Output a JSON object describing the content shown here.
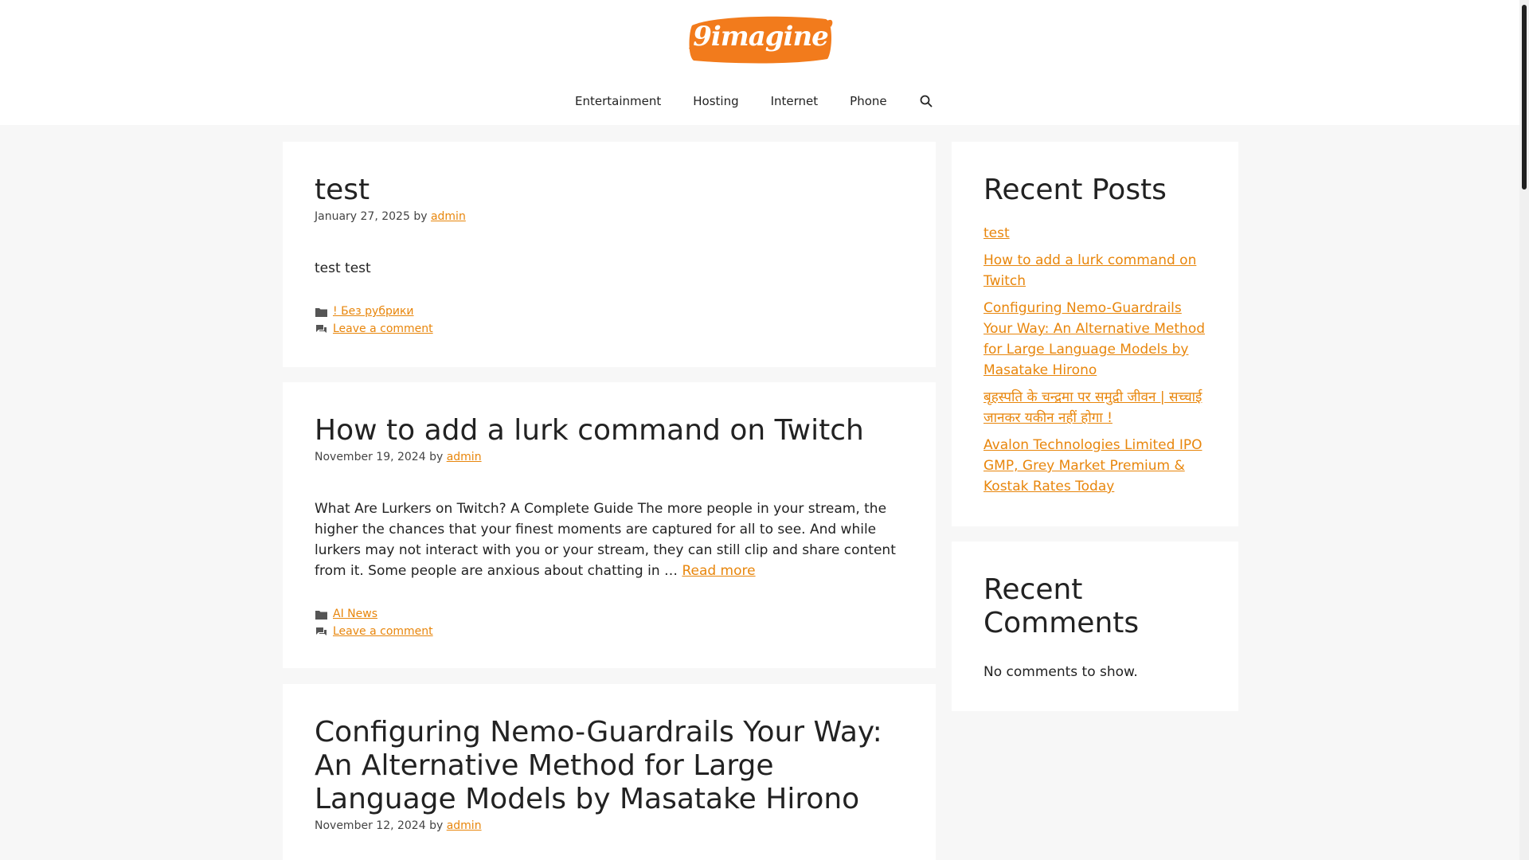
{
  "header": {
    "logo_text": "9imagine",
    "brand_color": "#f27b1c"
  },
  "nav": {
    "items": [
      {
        "label": "Entertainment"
      },
      {
        "label": "Hosting"
      },
      {
        "label": "Internet"
      },
      {
        "label": "Phone"
      }
    ],
    "search_icon": "search-icon"
  },
  "posts": [
    {
      "title": "test",
      "date": "January 27, 2025",
      "by": "by",
      "author": "admin",
      "excerpt": "test test",
      "category": "! Без рубрики",
      "comment_link": "Leave a comment"
    },
    {
      "title": "How to add a lurk command on Twitch",
      "date": "November 19, 2024",
      "by": "by",
      "author": "admin",
      "excerpt": "What Are Lurkers on Twitch? A Complete Guide The more people in your stream, the higher the chances that your finest moments are captured for all to see. And while lurkers may not interact with you or your stream, they can still clip and share content from it. Some people are anxious about chatting in … ",
      "read_more": "Read more",
      "category": "AI News",
      "comment_link": "Leave a comment"
    },
    {
      "title": "Configuring Nemo-Guardrails Your Way: An Alternative Method for Large Language Models by Masatake Hirono",
      "date": "November 12, 2024",
      "by": "by",
      "author": "admin"
    }
  ],
  "sidebar": {
    "recent_posts": {
      "title": "Recent Posts",
      "items": [
        {
          "label": "test"
        },
        {
          "label": "How to add a lurk command on Twitch"
        },
        {
          "label": "Configuring Nemo-Guardrails Your Way: An Alternative Method for Large Language Models by Masatake Hirono"
        },
        {
          "label": "बृहस्पति के चन्द्रमा पर समुद्री जीवन | सच्चाई जानकर यकीन नहीं होगा !"
        },
        {
          "label": "Avalon Technologies Limited IPO GMP, Grey Market Premium & Kostak Rates Today"
        }
      ]
    },
    "recent_comments": {
      "title": "Recent Comments",
      "empty_text": "No comments to show."
    }
  },
  "colors": {
    "link": "#e8860c",
    "text": "#222222",
    "background": "#f7f7f7",
    "card": "#ffffff"
  }
}
